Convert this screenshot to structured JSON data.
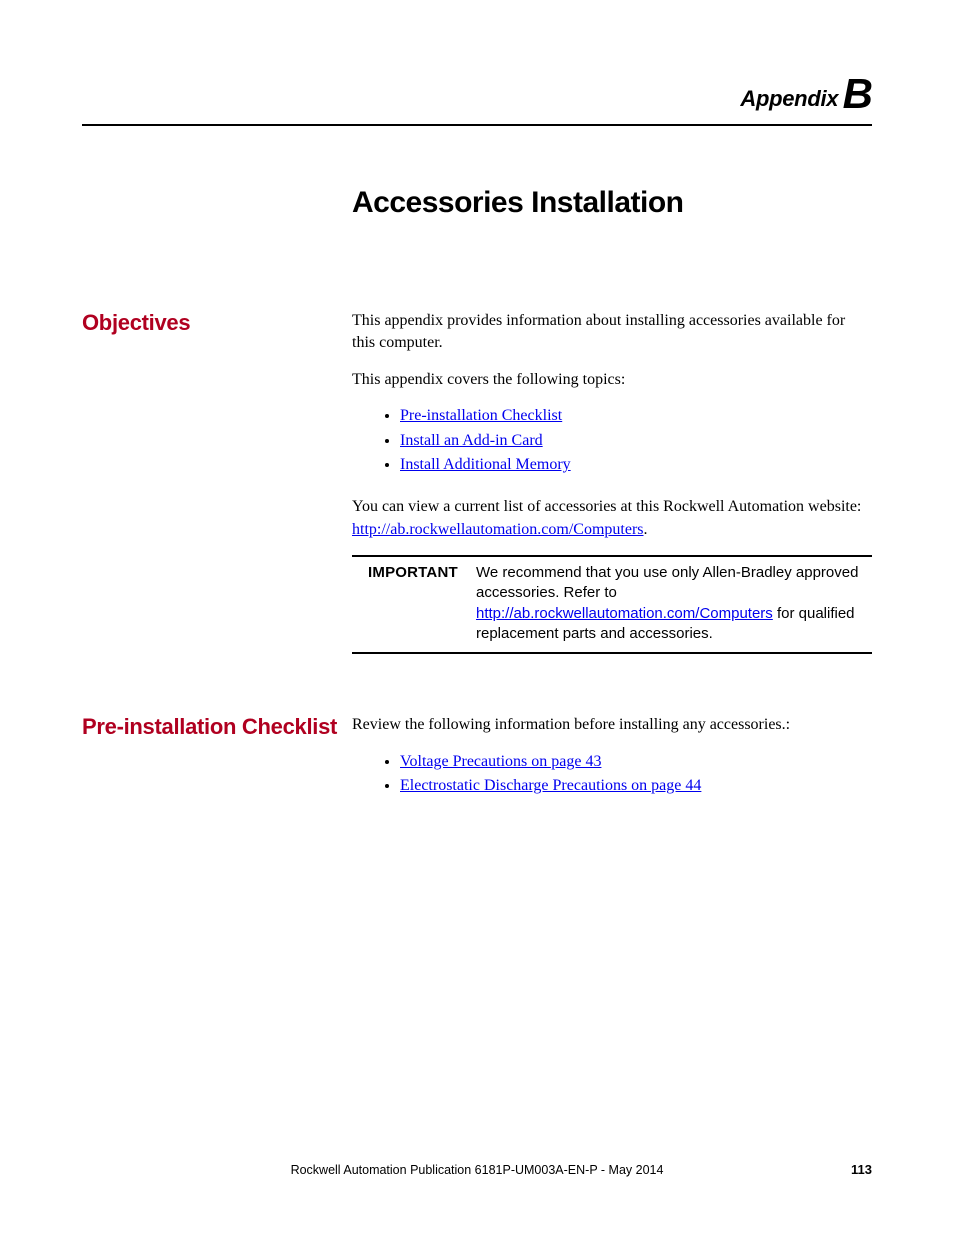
{
  "header": {
    "appendix_label": "Appendix",
    "appendix_letter": "B"
  },
  "page_title": "Accessories Installation",
  "sections": {
    "objectives": {
      "heading": "Objectives",
      "para1": "This appendix provides information about installing accessories available for this computer.",
      "para2": "This appendix covers the following topics:",
      "topics": [
        "Pre-installation Checklist",
        "Install an Add-in Card",
        "Install Additional Memory"
      ],
      "para3_a": "You can view a current list of accessories at this Rockwell Automation website: ",
      "para3_link": "http://ab.rockwellautomation.com/Computers",
      "para3_b": ".",
      "callout": {
        "label": "IMPORTANT",
        "text_a": "We recommend that you use only Allen-Bradley approved accessories. Refer to ",
        "link": "http://ab.rockwellautomation.com/Computers",
        "text_b": " for qualified replacement parts and accessories."
      }
    },
    "preinstall": {
      "heading": "Pre-installation Checklist",
      "para1": "Review the following information before installing any accessories.:",
      "items": [
        "Voltage Precautions on page 43",
        "Electrostatic Discharge Precautions on page 44"
      ]
    }
  },
  "footer": {
    "text": "Rockwell Automation Publication 6181P-UM003A-EN-P - May 2014",
    "page_number": "113"
  }
}
